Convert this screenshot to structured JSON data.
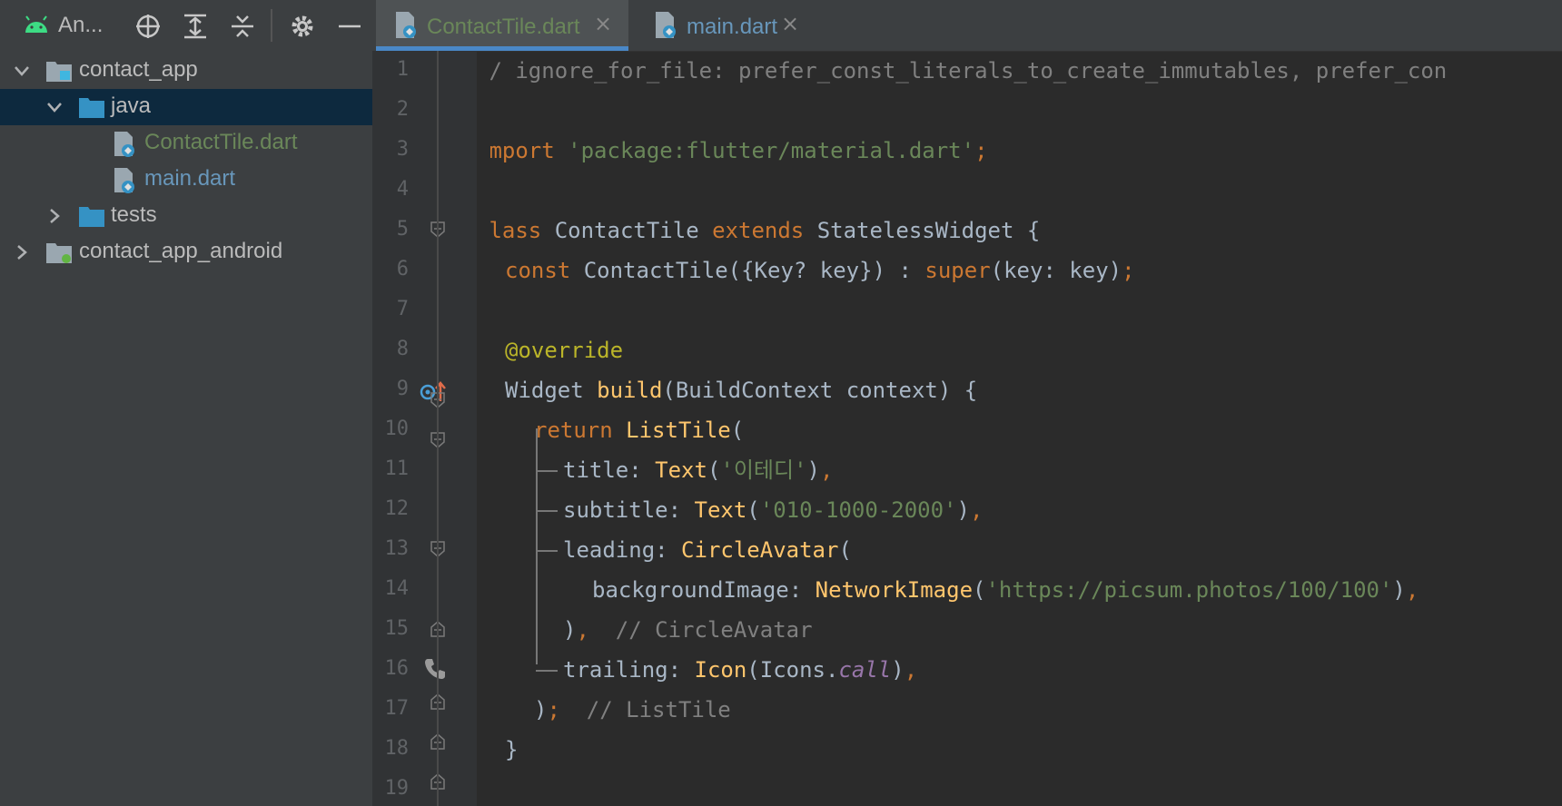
{
  "left_panel": {
    "title": "An...",
    "tree": [
      {
        "label": "contact_app",
        "color": "#d4d4d4",
        "icon": "module-folder-icon",
        "expanded": true
      },
      {
        "label": "java",
        "color": "#d4d4d4",
        "icon": "source-folder-icon",
        "expanded": true,
        "selected": true
      },
      {
        "label": "ContactTile.dart",
        "color": "#6a8759",
        "icon": "dart-file-icon"
      },
      {
        "label": "main.dart",
        "color": "#6897bb",
        "icon": "dart-file-icon"
      },
      {
        "label": "tests",
        "color": "#d4d4d4",
        "icon": "test-folder-icon",
        "expanded": false
      },
      {
        "label": "contact_app_android",
        "color": "#d4d4d4",
        "icon": "module-folder-icon",
        "expanded": false
      }
    ]
  },
  "tabs": [
    {
      "label": "ContactTile.dart",
      "active": true,
      "color": "#6a8759"
    },
    {
      "label": "main.dart",
      "active": false,
      "color": "#6897bb"
    }
  ],
  "line_numbers": [
    "1",
    "2",
    "3",
    "4",
    "5",
    "6",
    "7",
    "8",
    "9",
    "10",
    "11",
    "12",
    "13",
    "14",
    "15",
    "16",
    "17",
    "18",
    "19"
  ],
  "code": {
    "l1": "// ignore_for_file: prefer_const_literals_to_create_immutables, prefer_con",
    "l3_kw": "import",
    "l3_str": "'package:flutter/material.dart'",
    "l3_end": ";",
    "l5_kw1": "class",
    "l5_name": " ContactTile ",
    "l5_kw2": "extends",
    "l5_rest": " StatelessWidget {",
    "l6_kw": "const",
    "l6_a": " ContactTile({Key? key}) : ",
    "l6_super": "super",
    "l6_b": "(key: key)",
    "l6_end": ";",
    "l8_at": "@",
    "l8_ann": "override",
    "l9_a": "Widget ",
    "l9_fn": "build",
    "l9_b": "(BuildContext context) {",
    "l10_kw": "return",
    "l10_sp": " ",
    "l10_fn": "ListTile",
    "l10_b": "(",
    "l11_a": "title: ",
    "l11_fn": "Text",
    "l11_b": "(",
    "l11_str": "'이테디'",
    "l11_c": ")",
    "l11_end": ",",
    "l12_a": "subtitle: ",
    "l12_fn": "Text",
    "l12_b": "(",
    "l12_str": "'010-1000-2000'",
    "l12_c": ")",
    "l12_end": ",",
    "l13_a": "leading: ",
    "l13_fn": "CircleAvatar",
    "l13_b": "(",
    "l14_a": "backgroundImage: ",
    "l14_fn": "NetworkImage",
    "l14_b": "(",
    "l14_str": "'https://picsum.photos/100/100'",
    "l14_c": ")",
    "l14_end": ",",
    "l15_a": ")",
    "l15_b": ",",
    "l15_cm": "  // CircleAvatar",
    "l16_a": "trailing: ",
    "l16_fn": "Icon",
    "l16_b": "(Icons.",
    "l16_prop": "call",
    "l16_c": ")",
    "l16_end": ",",
    "l17_a": ")",
    "l17_b": ";",
    "l17_cm": "  // ListTile",
    "l18": "}",
    "l19": "}"
  }
}
